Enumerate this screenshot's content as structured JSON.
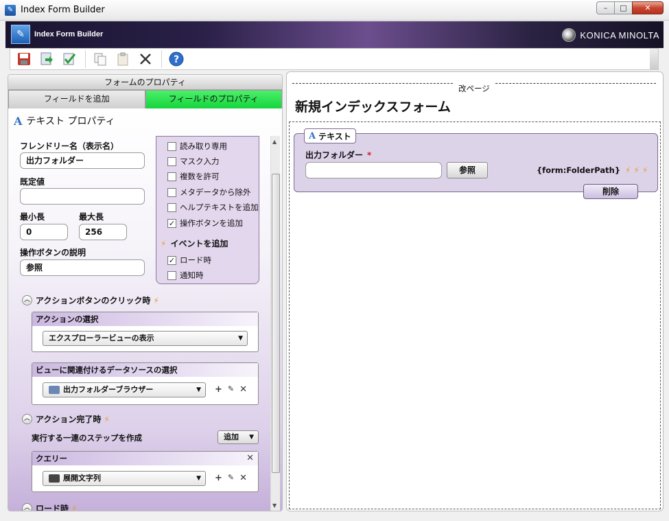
{
  "window": {
    "title": "Index Form Builder"
  },
  "banner": {
    "title": "Index Form Builder",
    "brand": "KONICA MINOLTA"
  },
  "toolbar": {
    "icons": [
      "save-icon",
      "save-close-icon",
      "validate-icon",
      "copy-icon",
      "paste-icon",
      "delete-icon",
      "help-icon"
    ]
  },
  "left": {
    "header": "フォームのプロパティ",
    "tabs": {
      "add": "フィールドを追加",
      "props": "フィールドのプロパティ"
    },
    "section_title": "テキスト プロパティ",
    "friendly_name_label": "フレンドリー名（表示名）",
    "friendly_name_value": "出力フォルダー",
    "default_label": "既定値",
    "default_value": "",
    "min_label": "最小長",
    "min_value": "0",
    "max_label": "最大長",
    "max_value": "256",
    "action_desc_label": "操作ボタンの説明",
    "action_desc_value": "参照",
    "options": {
      "readonly": "読み取り専用",
      "mask": "マスク入力",
      "multi": "複数を許可",
      "exclude_meta": "メタデータから除外",
      "help_text": "ヘルプテキストを追加",
      "action_button": "操作ボタンを追加",
      "events_title": "イベントを追加",
      "on_load": "ロード時",
      "on_notify": "通知時"
    },
    "click_section": "アクションボタンのクリック時",
    "action_select_title": "アクションの選択",
    "action_select_value": "エクスプローラービューの表示",
    "datasource_title": "ビューに関連付けるデータソースの選択",
    "datasource_value": "出力フォルダーブラウザー",
    "complete_section": "アクション完了時",
    "steps_label": "実行する一連のステップを作成",
    "add_button": "追加",
    "query_title": "クエリー",
    "query_value": "展開文字列",
    "onload_section": "ロード時"
  },
  "right": {
    "pagebreak": "改ページ",
    "form_title": "新規インデックスフォーム",
    "field_tag": "テキスト",
    "field_label": "出力フォルダー",
    "required_mark": "*",
    "browse_button": "参照",
    "binding": "{form:FolderPath}",
    "delete_button": "削除"
  }
}
